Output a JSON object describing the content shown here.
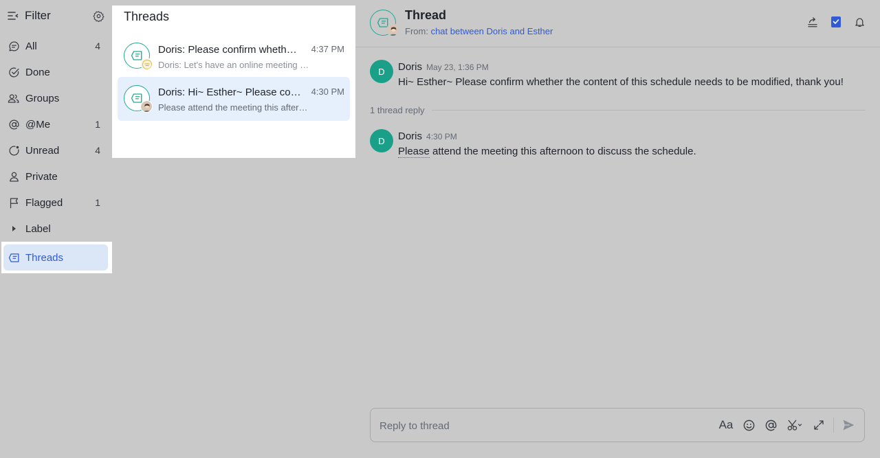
{
  "sidebar": {
    "title": "Filter",
    "items": [
      {
        "label": "All",
        "count": "4",
        "icon": "chat-bubble-icon"
      },
      {
        "label": "Done",
        "count": "",
        "icon": "check-circle-icon"
      },
      {
        "label": "Groups",
        "count": "",
        "icon": "group-icon"
      },
      {
        "label": "@Me",
        "count": "1",
        "icon": "at-icon"
      },
      {
        "label": "Unread",
        "count": "4",
        "icon": "unread-icon"
      },
      {
        "label": "Private",
        "count": "",
        "icon": "person-icon"
      },
      {
        "label": "Flagged",
        "count": "1",
        "icon": "flag-icon"
      },
      {
        "label": "Label",
        "count": "",
        "icon": "caret-right-icon"
      },
      {
        "label": "Threads",
        "count": "",
        "icon": "thread-icon"
      }
    ]
  },
  "threadlist": {
    "title": "Threads",
    "items": [
      {
        "name": "Doris: Please confirm whether the content of this schedule needs to be modified",
        "time": "4:37 PM",
        "preview": "Doris: Let's have an online meeting to discuss"
      },
      {
        "name": "Doris: Hi~ Esther~ Please confirm whether the content",
        "time": "4:30 PM",
        "preview": "Please attend the meeting this afternoon to discuss the schedule."
      }
    ]
  },
  "thread": {
    "title": "Thread",
    "from_label": "From:",
    "from_link": "chat between Doris and Esther",
    "messages": [
      {
        "avatar": "D",
        "author": "Doris",
        "time": "May 23, 1:36 PM",
        "body": "Hi~ Esther~ Please confirm whether the content of this schedule needs to be modified, thank you!"
      },
      {
        "avatar": "D",
        "author": "Doris",
        "time": "4:30 PM",
        "body_first": "Please",
        "body_rest": " attend the meeting this afternoon to discuss the schedule."
      }
    ],
    "reply_count": "1 thread reply"
  },
  "composer": {
    "placeholder": "Reply to thread",
    "format_label": "Aa"
  },
  "colors": {
    "accent": "#2f5bd6",
    "avatar_green": "#1aa088",
    "active_bg": "#dbe6f7"
  }
}
